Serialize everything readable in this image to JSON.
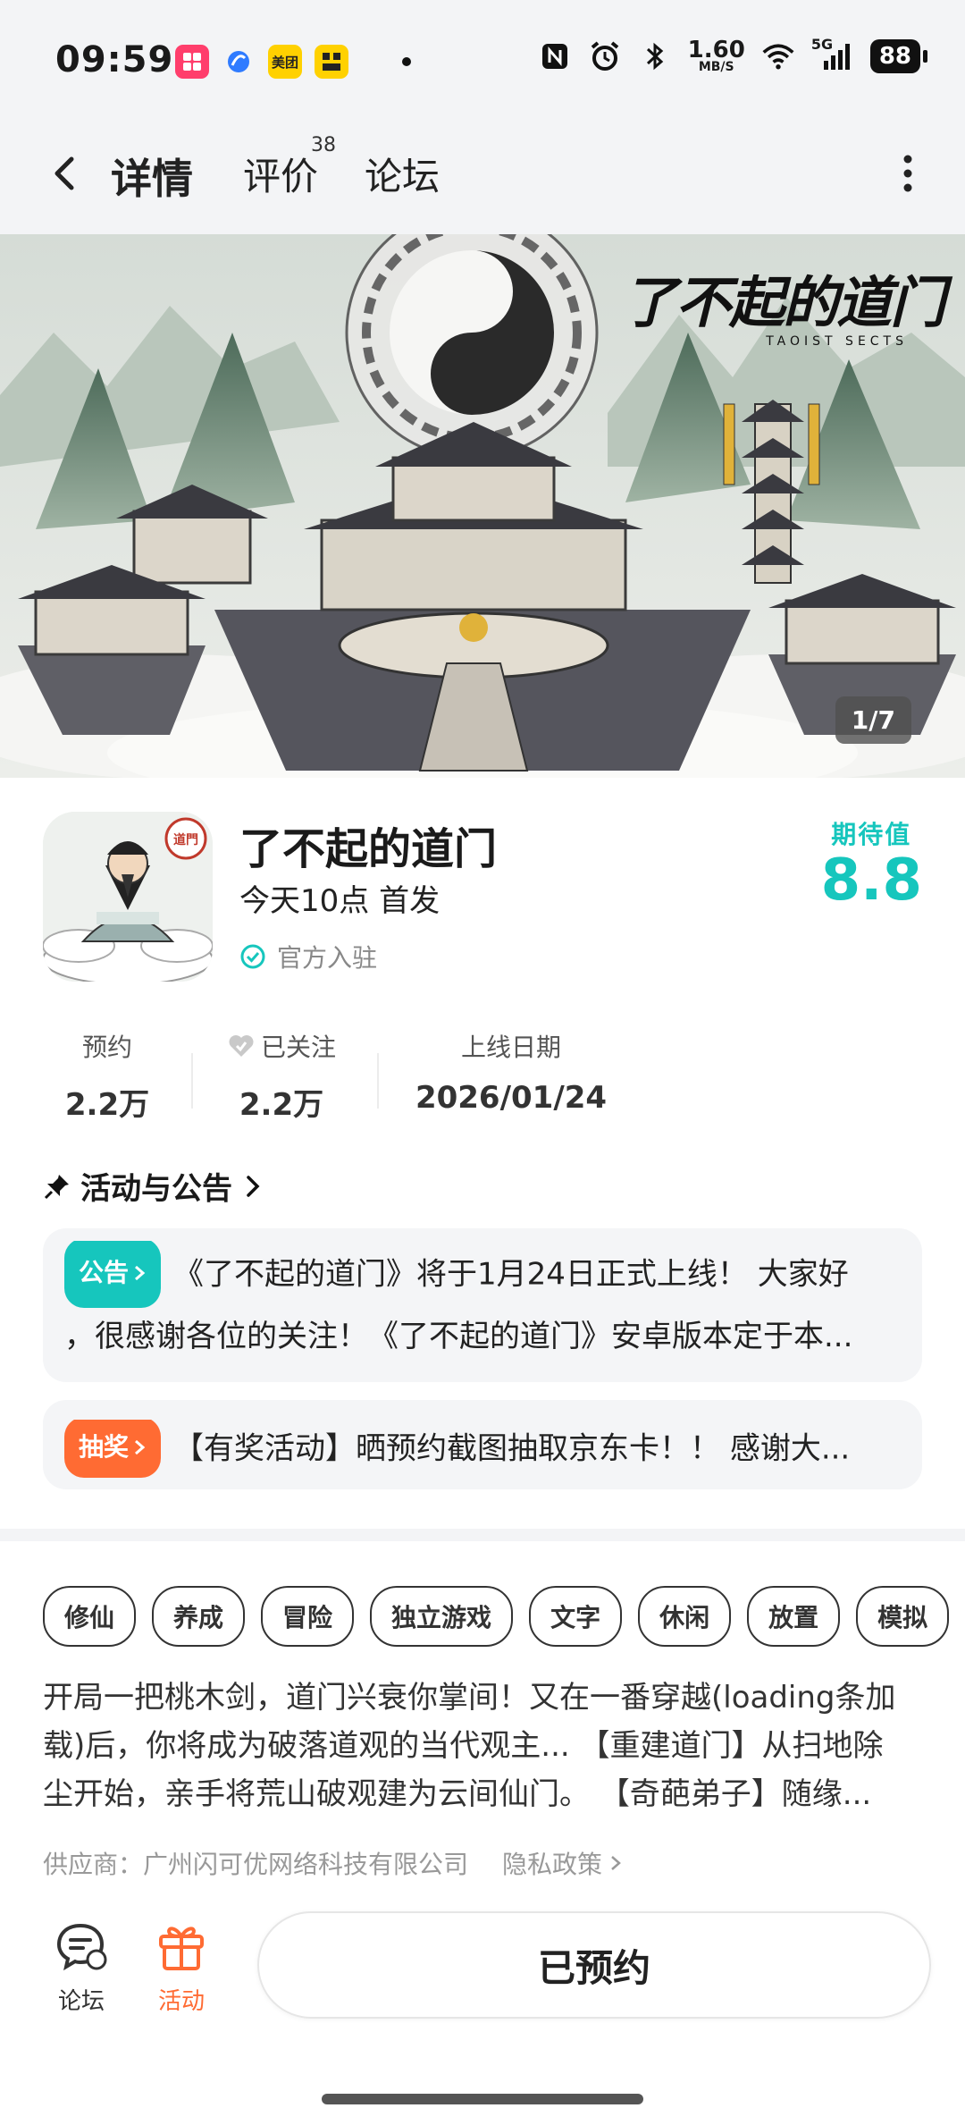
{
  "status_bar": {
    "time": "09:59",
    "apps": [
      {
        "name": "app-1",
        "label": "",
        "color": "#ff3e6c"
      },
      {
        "name": "app-2",
        "label": "",
        "color": "#2f7bff"
      },
      {
        "name": "app-3",
        "label": "美团",
        "color": "#ffd100"
      },
      {
        "name": "app-4",
        "label": "",
        "color": "#ffd100"
      }
    ],
    "net_speed_value": "1.60",
    "net_speed_unit": "MB/S",
    "signal": "5G",
    "battery": "88"
  },
  "nav": {
    "tabs": [
      {
        "label": "详情",
        "active": true
      },
      {
        "label": "评价",
        "badge": "38"
      },
      {
        "label": "论坛"
      }
    ],
    "accent": "#16c6bd"
  },
  "banner": {
    "title": "了不起的道门",
    "subtitle": "TAOIST SECTS",
    "counter": "1/7"
  },
  "game": {
    "name": "了不起的道门",
    "release": "今天10点 首发",
    "official": "官方入驻",
    "icon_badge": "道門",
    "expect_label": "期待值",
    "expect_value": "8.8"
  },
  "stats": [
    {
      "label": "预约",
      "value": "2.2万"
    },
    {
      "label": "已关注",
      "value": "2.2万"
    },
    {
      "label": "上线日期",
      "value": "2026/01/24"
    }
  ],
  "activities": {
    "title": "活动与公告",
    "items": [
      {
        "tag": "公告",
        "line1": "《了不起的道门》将于1月24日正式上线！ 大家好",
        "line2": "，很感谢各位的关注！《了不起的道门》安卓版本定于本..."
      },
      {
        "tag": "抽奖",
        "line1": "【有奖活动】晒预约截图抽取京东卡！！ 感谢大..."
      }
    ]
  },
  "tags": [
    "修仙",
    "养成",
    "冒险",
    "独立游戏",
    "文字",
    "休闲",
    "放置",
    "模拟"
  ],
  "description": {
    "line1": "开局一把桃木剑，道门兴衰你掌间！又在一番穿越(loading条加",
    "line2": "载)后，你将成为破落道观的当代观主... 【重建道门】从扫地除",
    "line3": "尘开始，亲手将荒山破观建为云间仙门。 【奇葩弟子】随缘..."
  },
  "supplier": {
    "text": "供应商：广州闪可优网络科技有限公司",
    "privacy": "隐私政策"
  },
  "bottom": {
    "forum": "论坛",
    "activity": "活动",
    "reserve": "已预约",
    "activity_color": "#ff6b33"
  }
}
